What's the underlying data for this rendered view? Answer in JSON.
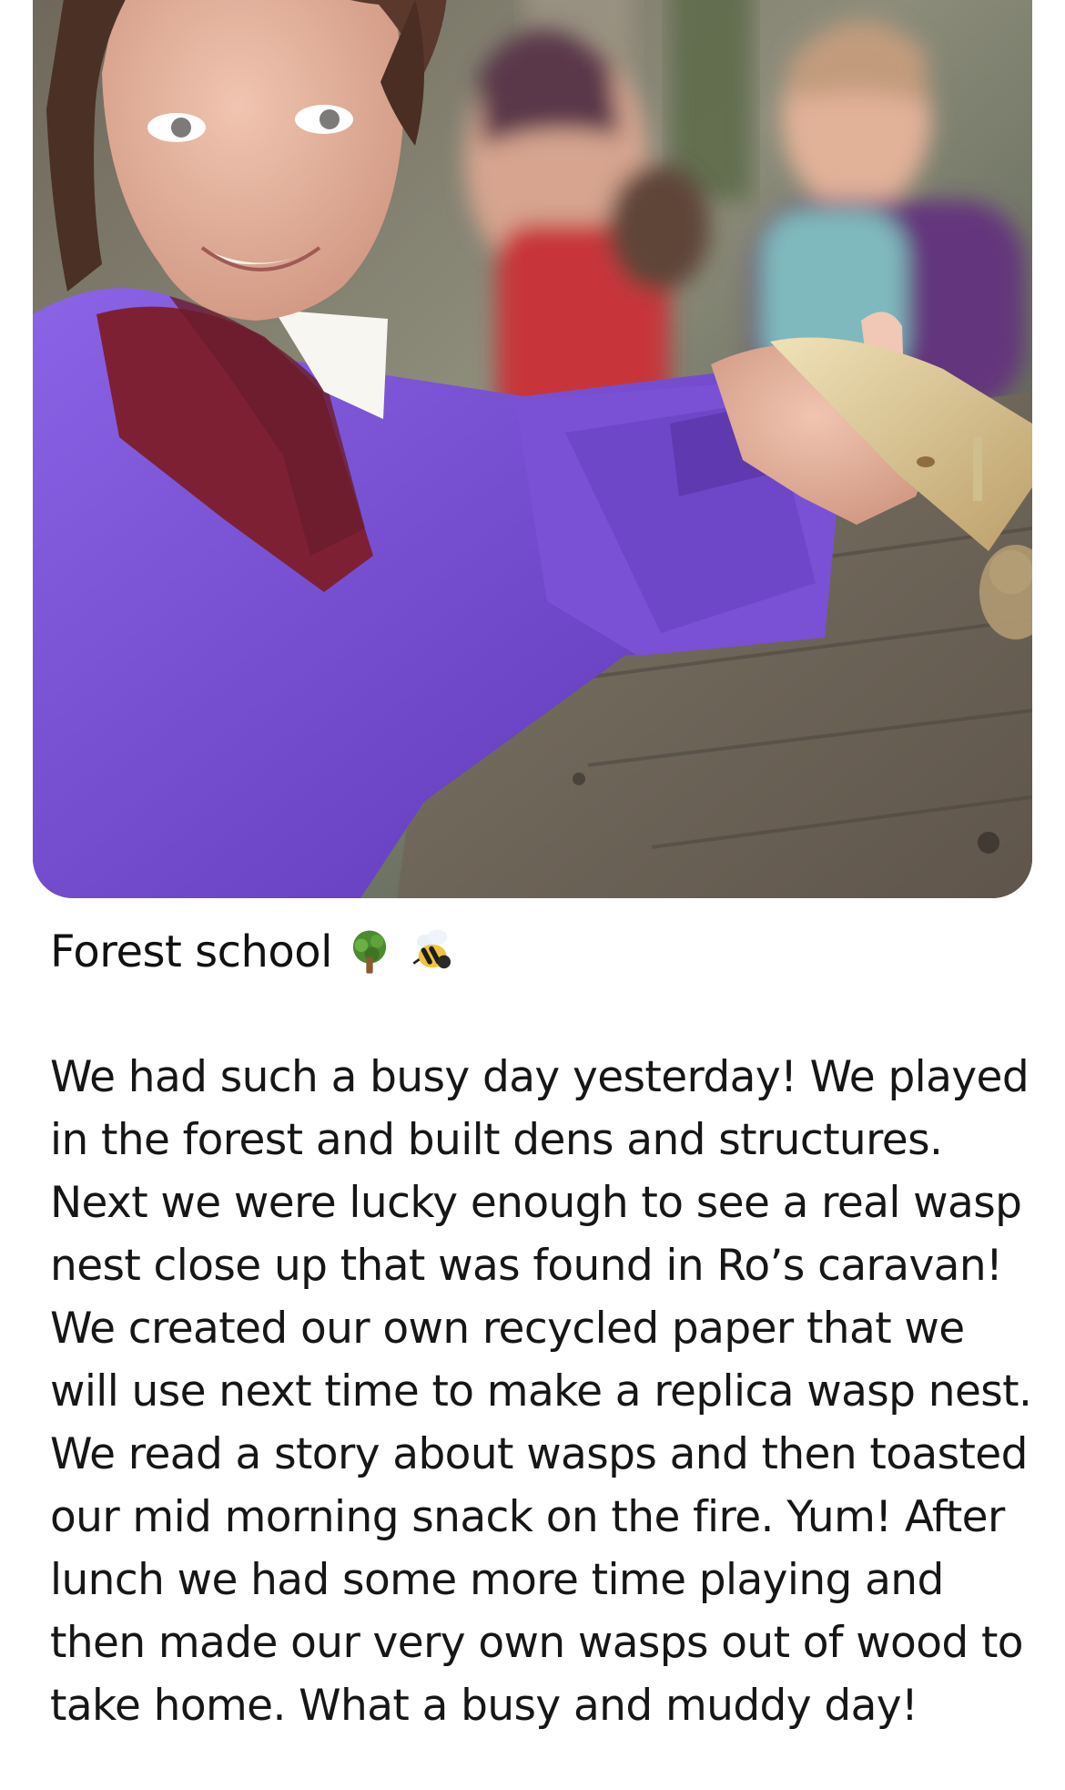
{
  "post": {
    "title": "Forest school",
    "title_emojis": [
      "tree-emoji",
      "bee-emoji"
    ],
    "body": "We had such a busy day yesterday! We played in the forest and built dens and structures. Next we were lucky enough to see a real wasp nest close up that was found in Ro’s caravan! We created our own recycled paper that we will use next time to make a replica wasp nest. We read a story about wasps and then toasted our mid morning snack on the fire. Yum! After lunch we had some more time playing and then made our very own wasps out of wood to take home. What a busy and muddy day!"
  },
  "photo": {
    "subject": "photo"
  },
  "colors": {
    "jacket": "#7a4fd1",
    "fleece": "#7d1f2f",
    "wood": "#d8c79a",
    "table": "#8d8270",
    "background_blur": "#6d7666"
  }
}
